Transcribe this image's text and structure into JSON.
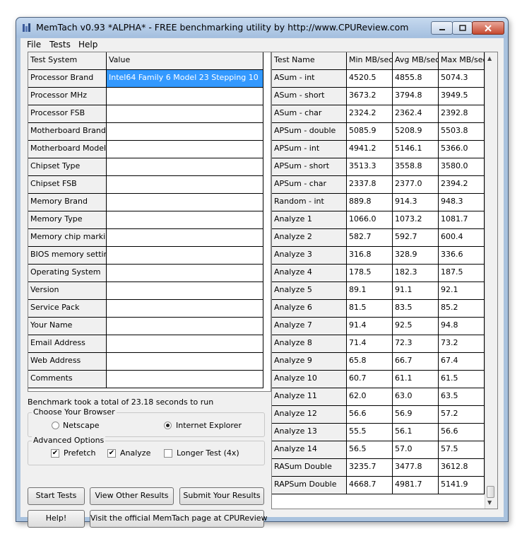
{
  "window": {
    "title": "MemTach v0.93 *ALPHA* - FREE benchmarking utility by http://www.CPUReview.com"
  },
  "menu": [
    "File",
    "Tests",
    "Help"
  ],
  "system_table": {
    "headers": [
      "Test System",
      "Value"
    ],
    "rows": [
      [
        "Processor Brand",
        "Intel64 Family 6 Model 23 Stepping 10"
      ],
      [
        "Processor MHz",
        ""
      ],
      [
        "Processor FSB",
        ""
      ],
      [
        "Motherboard Brand",
        ""
      ],
      [
        "Motherboard Model",
        ""
      ],
      [
        "Chipset Type",
        ""
      ],
      [
        "Chipset FSB",
        ""
      ],
      [
        "Memory Brand",
        ""
      ],
      [
        "Memory Type",
        ""
      ],
      [
        "Memory chip markings",
        ""
      ],
      [
        "BIOS memory settings",
        ""
      ],
      [
        "Operating System",
        ""
      ],
      [
        "Version",
        ""
      ],
      [
        "Service Pack",
        ""
      ],
      [
        "Your Name",
        ""
      ],
      [
        "Email Address",
        ""
      ],
      [
        "Web Address",
        ""
      ],
      [
        "Comments",
        ""
      ]
    ]
  },
  "results_table": {
    "headers": [
      "Test Name",
      "Min MB/sec",
      "Avg MB/sec",
      "Max MB/sec"
    ],
    "rows": [
      [
        "ASum - int",
        "4520.5",
        "4855.8",
        "5074.3"
      ],
      [
        "ASum - short",
        "3673.2",
        "3794.8",
        "3949.5"
      ],
      [
        "ASum - char",
        "2324.2",
        "2362.4",
        "2392.8"
      ],
      [
        "APSum - double",
        "5085.9",
        "5208.9",
        "5503.8"
      ],
      [
        "APSum - int",
        "4941.2",
        "5146.1",
        "5366.0"
      ],
      [
        "APSum - short",
        "3513.3",
        "3558.8",
        "3580.0"
      ],
      [
        "APSum - char",
        "2337.8",
        "2377.0",
        "2394.2"
      ],
      [
        "Random - int",
        "889.8",
        "914.3",
        "948.3"
      ],
      [
        "Analyze 1",
        "1066.0",
        "1073.2",
        "1081.7"
      ],
      [
        "Analyze 2",
        "582.7",
        "592.7",
        "600.4"
      ],
      [
        "Analyze 3",
        "316.8",
        "328.9",
        "336.6"
      ],
      [
        "Analyze 4",
        "178.5",
        "182.3",
        "187.5"
      ],
      [
        "Analyze 5",
        "89.1",
        "91.1",
        "92.1"
      ],
      [
        "Analyze 6",
        "81.5",
        "83.5",
        "85.2"
      ],
      [
        "Analyze 7",
        "91.4",
        "92.5",
        "94.8"
      ],
      [
        "Analyze 8",
        "71.4",
        "72.3",
        "73.2"
      ],
      [
        "Analyze 9",
        "65.8",
        "66.7",
        "67.4"
      ],
      [
        "Analyze 10",
        "60.7",
        "61.1",
        "61.5"
      ],
      [
        "Analyze 11",
        "62.0",
        "63.0",
        "63.5"
      ],
      [
        "Analyze 12",
        "56.6",
        "56.9",
        "57.2"
      ],
      [
        "Analyze 13",
        "55.5",
        "56.1",
        "56.6"
      ],
      [
        "Analyze 14",
        "56.5",
        "57.0",
        "57.5"
      ],
      [
        "RASum Double",
        "3235.7",
        "3477.8",
        "3612.8"
      ],
      [
        "RAPSum Double",
        "4668.7",
        "4981.7",
        "5141.9"
      ]
    ]
  },
  "status": "Benchmark took a total of 23.18 seconds to run",
  "browser_group": {
    "label": "Choose Your Browser",
    "options": [
      "Netscape",
      "Internet Explorer"
    ],
    "selected": "Internet Explorer"
  },
  "advanced_group": {
    "label": "Advanced Options",
    "prefetch": {
      "label": "Prefetch",
      "checked": true
    },
    "analyze": {
      "label": "Analyze",
      "checked": true
    },
    "longer": {
      "label": "Longer Test (4x)",
      "checked": false
    }
  },
  "buttons": {
    "start": "Start Tests",
    "view": "View Other Results",
    "submit": "Submit Your Results",
    "help": "Help!",
    "visit": "Visit the official MemTach page at CPUReview"
  },
  "icons": {
    "app": "app-icon",
    "minimize": "minimize-icon",
    "maximize": "maximize-icon",
    "close": "close-icon",
    "radio_selected": "radio-dot-icon",
    "check": "checkmark-icon",
    "scroll_up": "scroll-up-arrow-icon",
    "scroll_down": "scroll-down-arrow-icon"
  },
  "colors": {
    "selection": "#3399ff",
    "titlebar": "#a4bfdf",
    "close_button": "#c6492f"
  }
}
